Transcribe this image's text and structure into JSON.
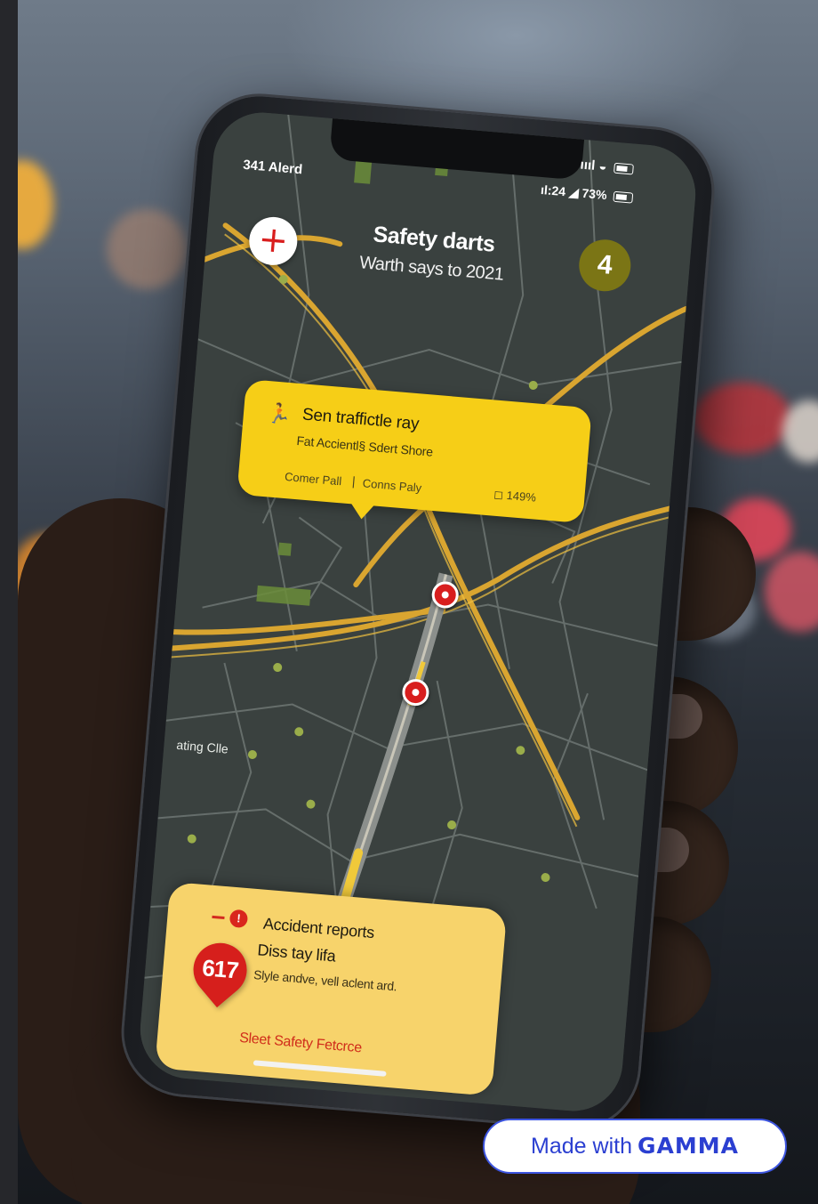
{
  "status_bar": {
    "left": "341 Alerd",
    "top_right": "ıııl",
    "right": "ıl:24 ◢ 73%"
  },
  "header": {
    "add_symbol": "+",
    "title": "Safety darts",
    "subtitle": "Warth says to 2021",
    "count": "4"
  },
  "alert_card": {
    "icon": "running-person-icon",
    "title": "Sen traffictle ray",
    "subtitle": "Fat Accientl§ Sdert Shore",
    "left_label": "Comer Pall",
    "separator": "|",
    "mid_label": "Conns Paly",
    "right_label": "◻ 149%"
  },
  "map": {
    "place_label": "ating Clle",
    "pins": 2
  },
  "report_card": {
    "dot_label": "!",
    "title": "Accident reports",
    "subtitle": "Diss tay lifa",
    "description": "Slyle andve, vell aclent ard.",
    "marker_number": "617",
    "link": "Sleet Safety Fetcrce"
  },
  "badge": {
    "made_with": "Made with",
    "brand": "GAMMA"
  },
  "colors": {
    "alert_yellow": "#f6ce17",
    "report_yellow": "#f7d36b",
    "pin_red": "#d81e1e",
    "map_bg": "#3a413f",
    "road_gold": "#d9a530",
    "badge_blue": "#3d55e0"
  }
}
